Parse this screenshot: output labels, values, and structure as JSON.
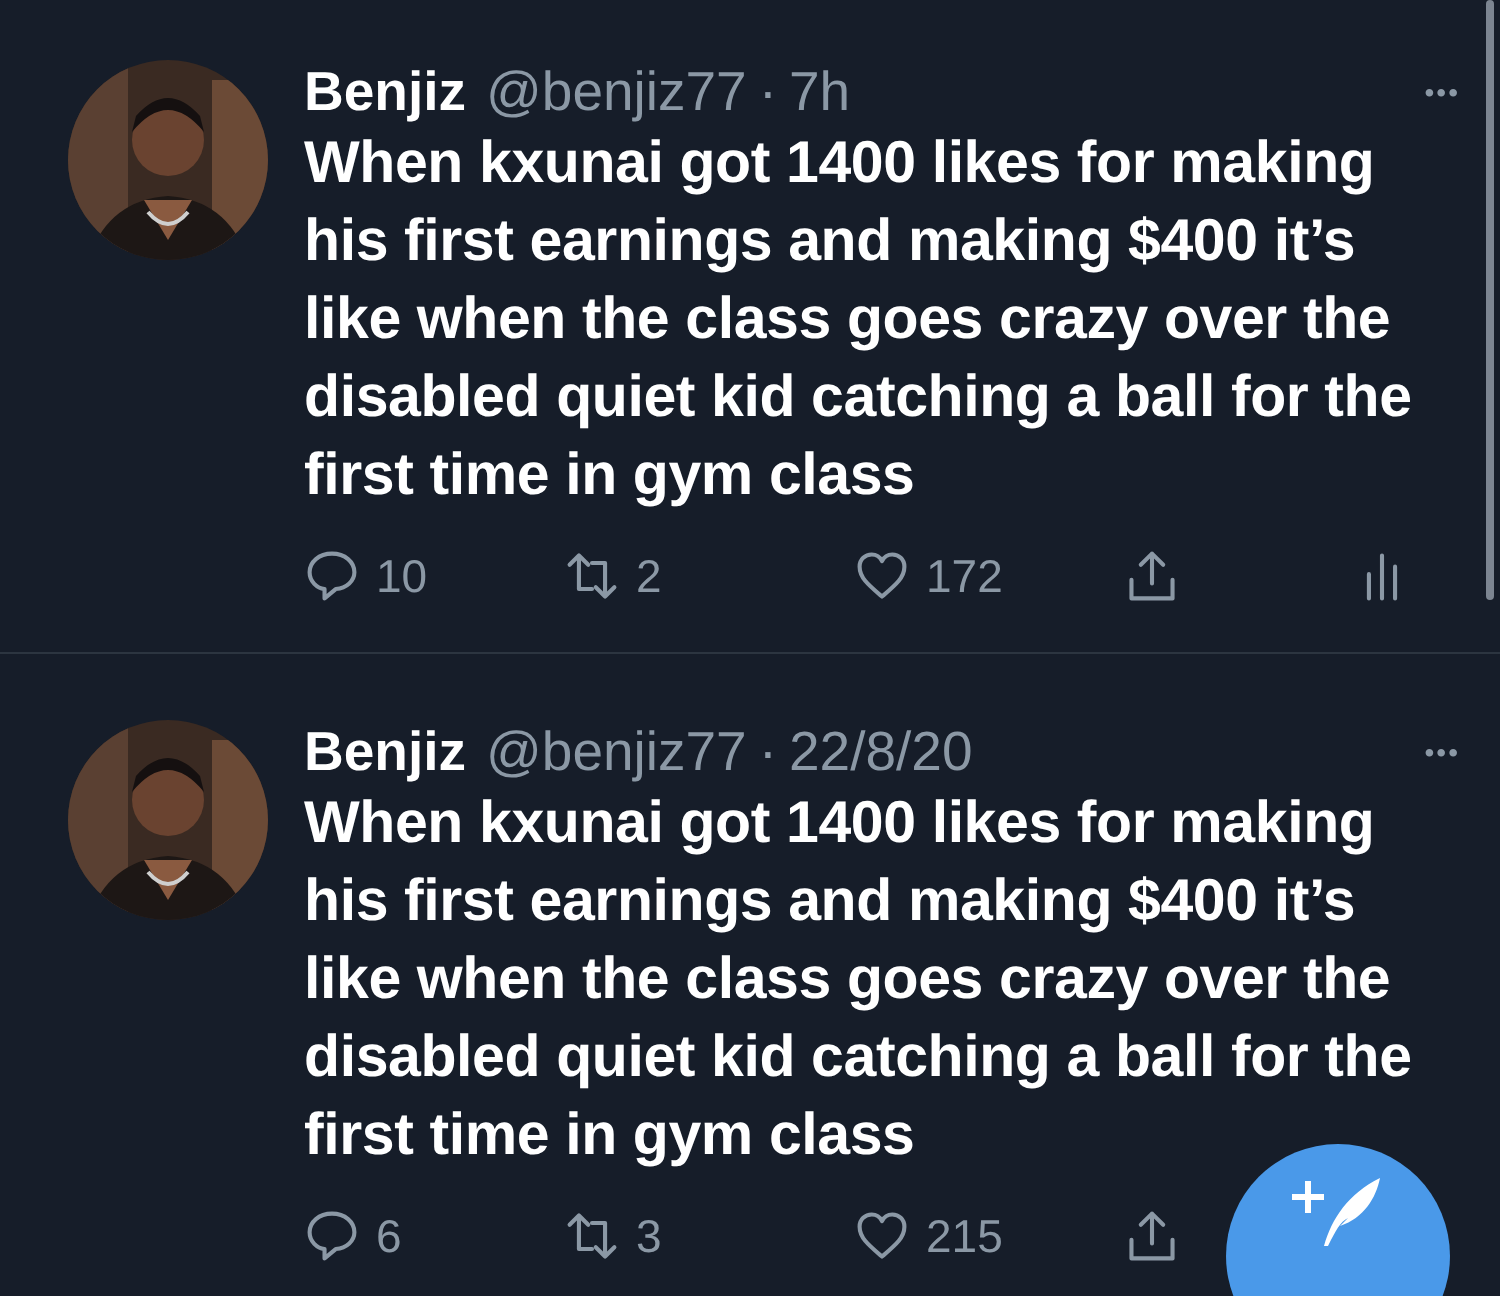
{
  "tweets": [
    {
      "name": "Benjiz",
      "handle": "@benjiz77",
      "separator": "·",
      "time": "7h",
      "menu": "•••",
      "text": "When kxunai got 1400 likes for making his first earnings and making $400 it’s like when the class goes crazy over the disabled quiet kid catching a ball for the first time in gym class",
      "replies": "10",
      "retweets": "2",
      "likes": "172",
      "analytics": true
    },
    {
      "name": "Benjiz",
      "handle": "@benjiz77",
      "separator": "·",
      "time": "22/8/20",
      "menu": "•••",
      "text": "When kxunai got 1400 likes for making his first earnings and making $400 it’s like when the class goes crazy over the disabled quiet kid catching a ball for the first time in gym class",
      "replies": "6",
      "retweets": "3",
      "likes": "215"
    }
  ]
}
